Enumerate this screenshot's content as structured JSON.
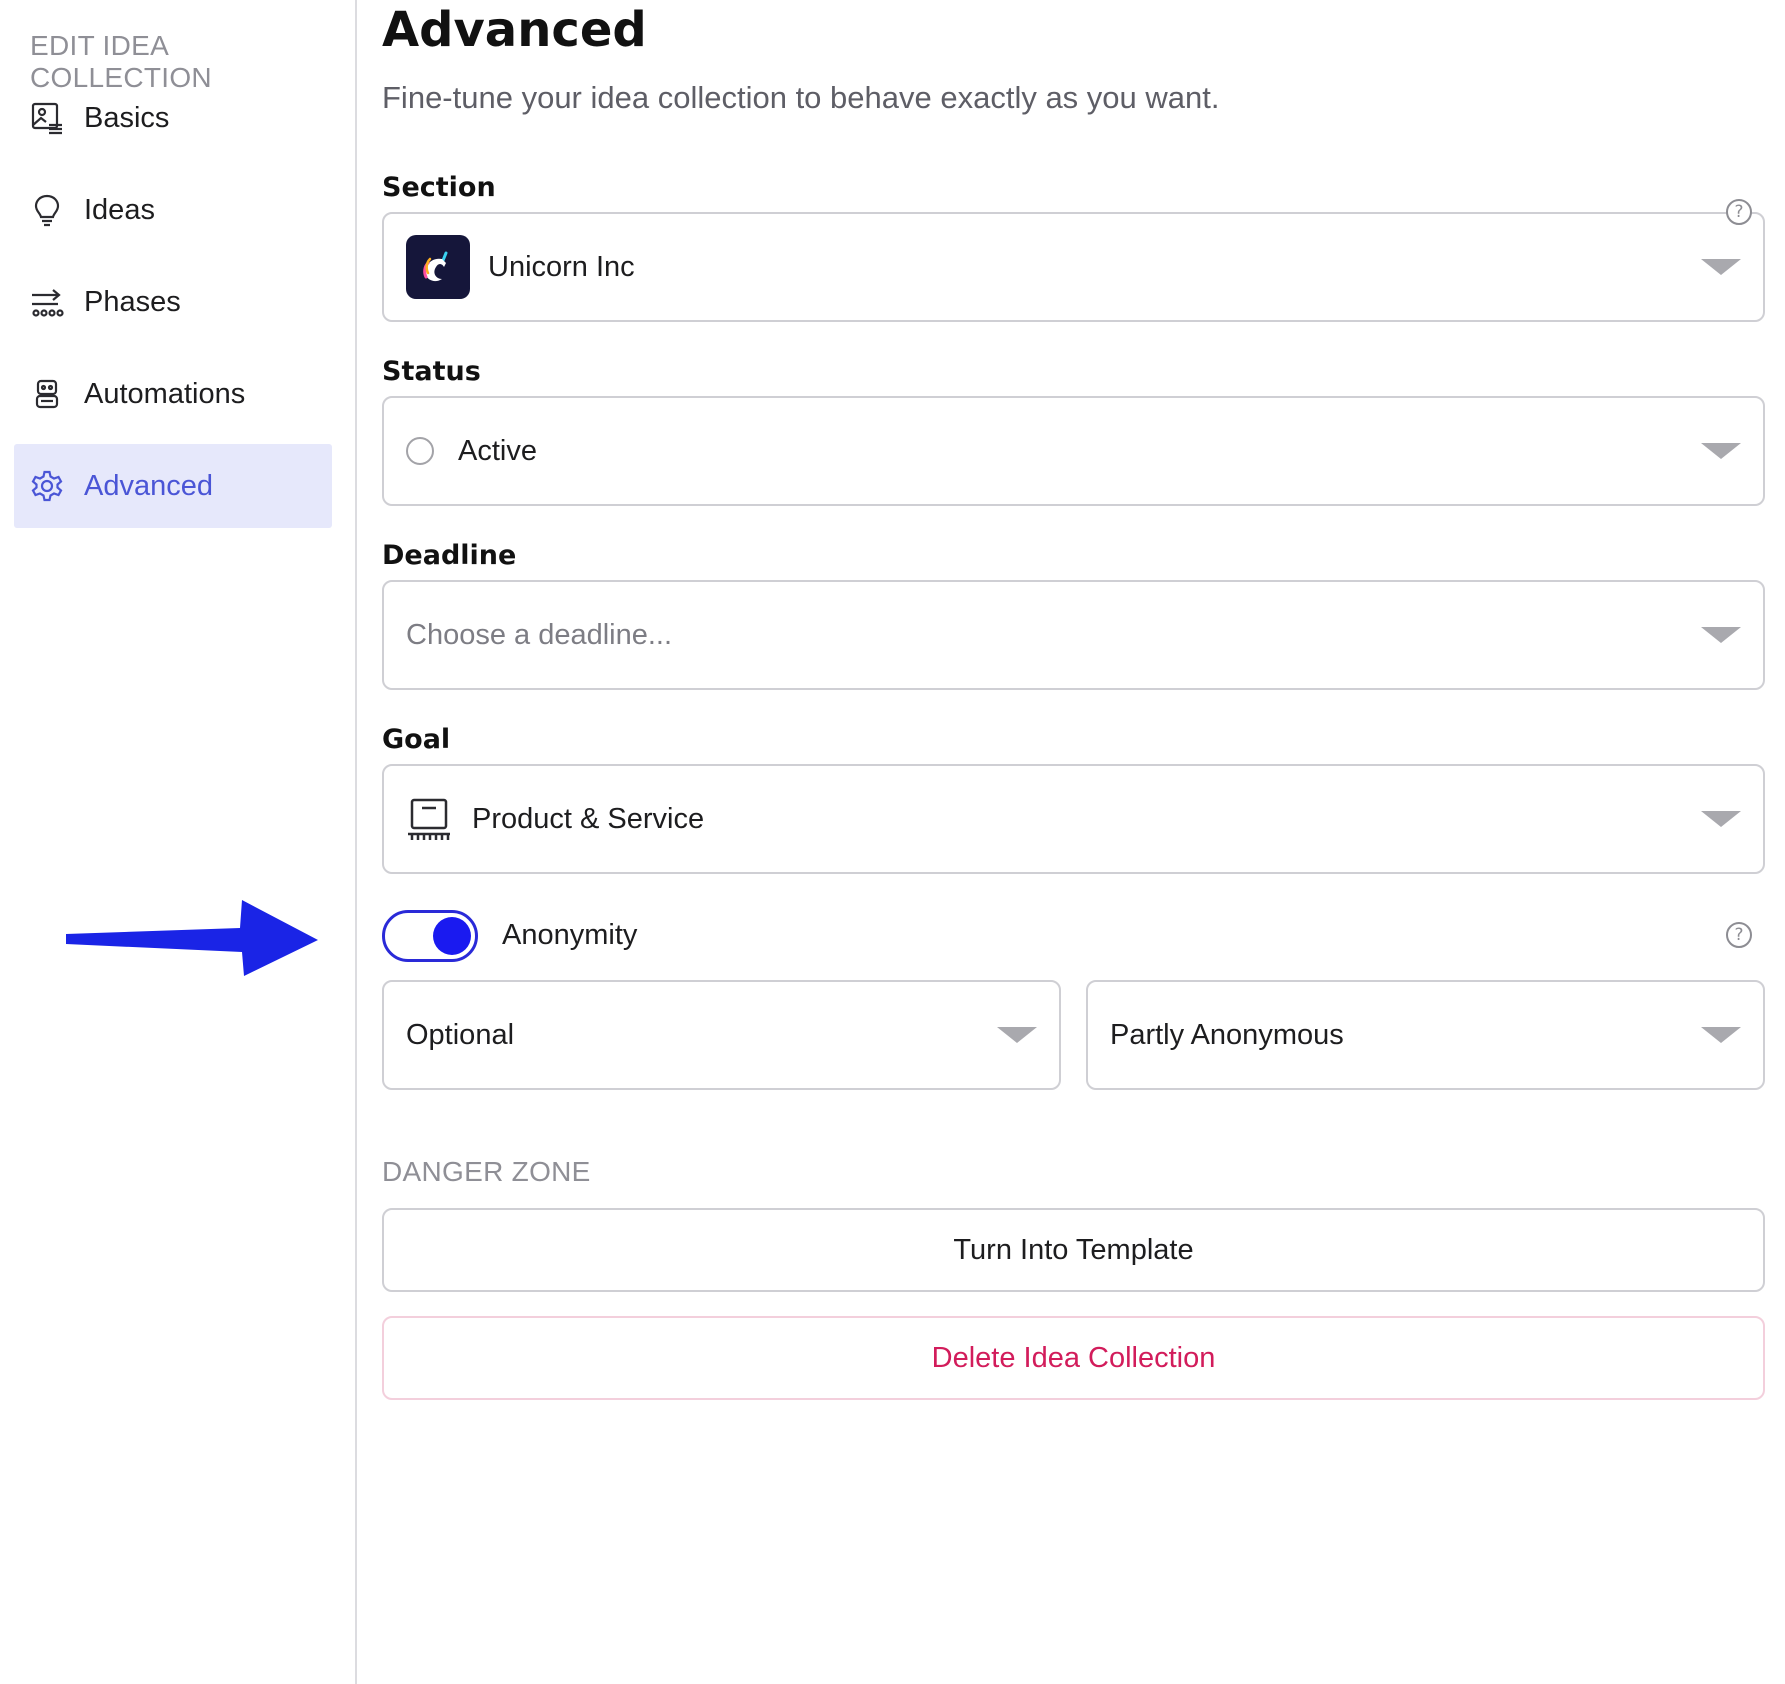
{
  "sidebar": {
    "heading": "EDIT IDEA COLLECTION",
    "items": [
      {
        "label": "Basics",
        "icon": "image-edit-icon",
        "active": false
      },
      {
        "label": "Ideas",
        "icon": "lightbulb-icon",
        "active": false
      },
      {
        "label": "Phases",
        "icon": "phases-icon",
        "active": false
      },
      {
        "label": "Automations",
        "icon": "robot-icon",
        "active": false
      },
      {
        "label": "Advanced",
        "icon": "gear-icon",
        "active": true
      }
    ]
  },
  "page": {
    "title": "Advanced",
    "subtitle": "Fine-tune your idea collection to behave exactly as you want."
  },
  "section": {
    "label": "Section",
    "value": "Unicorn Inc",
    "icon": "unicorn-logo-icon"
  },
  "status": {
    "label": "Status",
    "value": "Active"
  },
  "deadline": {
    "label": "Deadline",
    "placeholder": "Choose a deadline..."
  },
  "goal": {
    "label": "Goal",
    "value": "Product & Service",
    "icon": "product-service-icon"
  },
  "anonymity": {
    "label": "Anonymity",
    "enabled": true,
    "mode_value": "Optional",
    "level_value": "Partly Anonymous"
  },
  "danger_zone": {
    "heading": "DANGER ZONE",
    "template_button": "Turn Into Template",
    "delete_button": "Delete Idea Collection"
  },
  "colors": {
    "accent": "#4a55d6",
    "toggle": "#1a1af0",
    "danger": "#d21c5b",
    "annotation_arrow": "#1a24e6"
  }
}
